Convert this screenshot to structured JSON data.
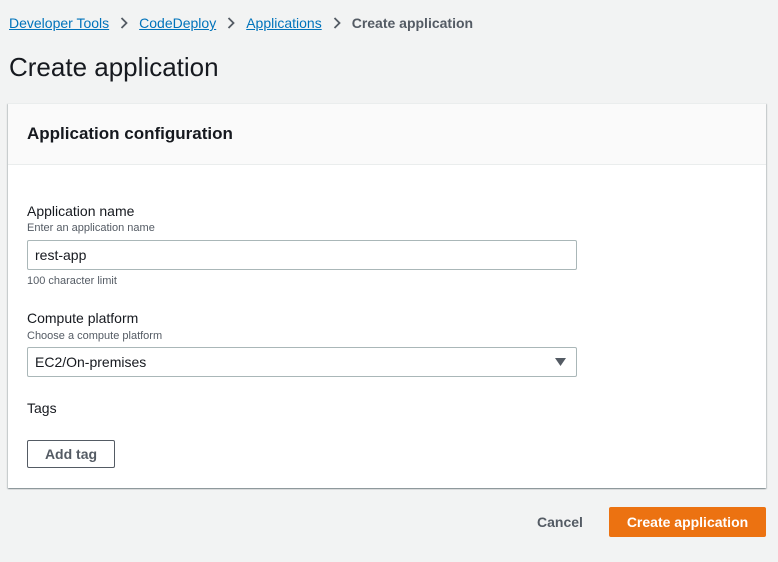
{
  "breadcrumb": {
    "items": [
      "Developer Tools",
      "CodeDeploy",
      "Applications"
    ],
    "current": "Create application"
  },
  "page_title": "Create application",
  "panel": {
    "title": "Application configuration",
    "app_name": {
      "label": "Application name",
      "description": "Enter an application name",
      "value": "rest-app",
      "constraint": "100 character limit"
    },
    "compute_platform": {
      "label": "Compute platform",
      "description": "Choose a compute platform",
      "selected": "EC2/On-premises"
    },
    "tags": {
      "label": "Tags",
      "add_button": "Add tag"
    }
  },
  "footer": {
    "cancel": "Cancel",
    "submit": "Create application"
  },
  "colors": {
    "primary": "#ec7211",
    "link": "#0073bb",
    "background": "#f2f3f3"
  },
  "icons": {
    "breadcrumb_separator": "chevron-right-icon",
    "select_caret": "caret-down-icon"
  }
}
